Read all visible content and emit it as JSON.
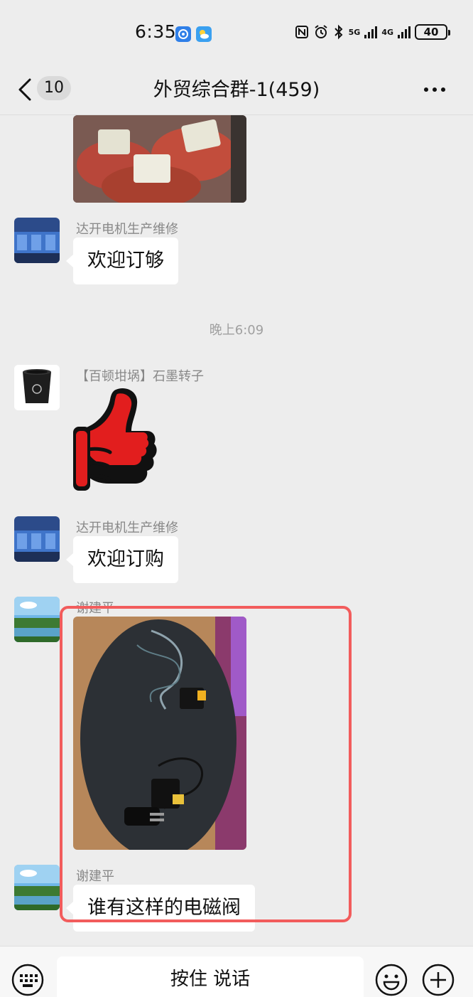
{
  "status": {
    "time": "6:35",
    "net_5g": "5G",
    "net_4g": "4G",
    "battery": "40"
  },
  "header": {
    "unread_count": "10",
    "title": "外贸综合群-1(459)"
  },
  "messages": [
    {
      "sender": "达开电机生产维修",
      "text": "欢迎订够"
    },
    {
      "sender": "【百顿坩埚】石墨转子"
    },
    {
      "sender": "达开电机生产维修",
      "text": "欢迎订购"
    },
    {
      "sender": "谢建平"
    },
    {
      "sender": "谢建平",
      "text": "谁有这样的电磁阀"
    }
  ],
  "timestamp": "晚上6:09",
  "input": {
    "hold_to_talk": "按住 说话"
  },
  "colors": {
    "highlight": "#f25c5c",
    "background": "#ededed"
  }
}
